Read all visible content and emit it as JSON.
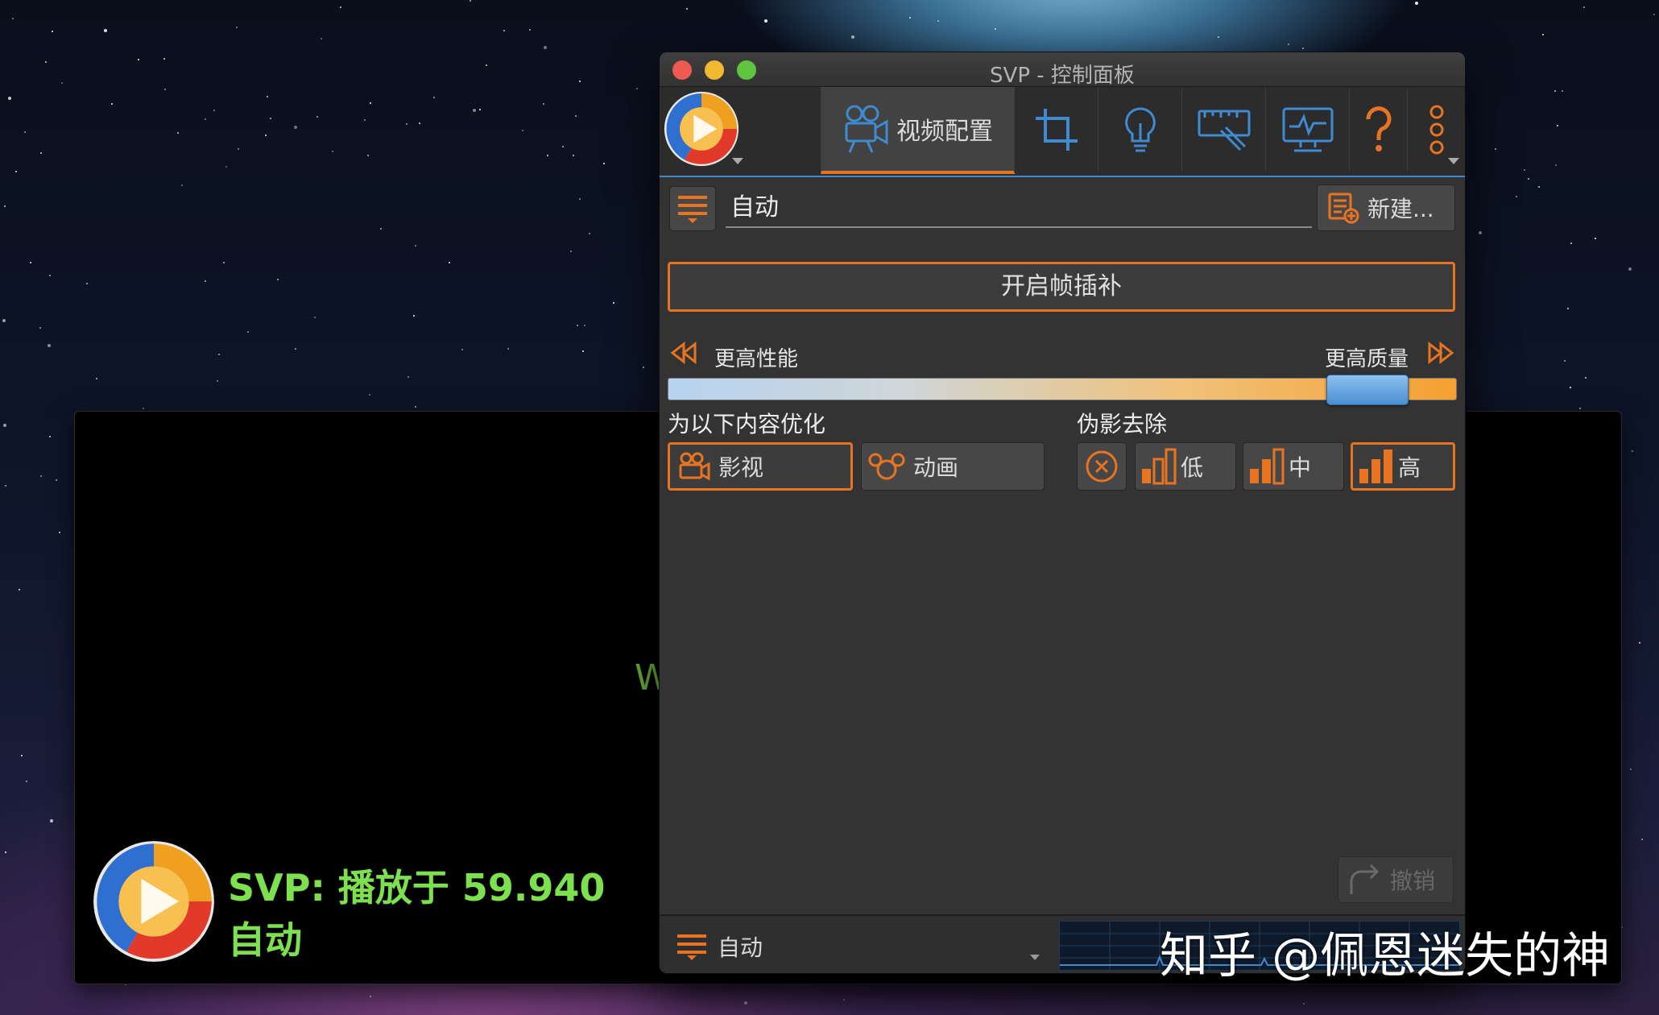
{
  "window": {
    "title": "SVP - 控制面板"
  },
  "toolbar": {
    "tabs": [
      {
        "label": "视频配置",
        "icon": "video-camera-icon",
        "active": true
      },
      {
        "label": "",
        "icon": "crop-icon",
        "active": false
      },
      {
        "label": "",
        "icon": "lightbulb-icon",
        "active": false
      },
      {
        "label": "",
        "icon": "ruler-edit-icon",
        "active": false
      },
      {
        "label": "",
        "icon": "monitor-icon",
        "active": false
      },
      {
        "label": "",
        "icon": "help-icon",
        "active": false
      },
      {
        "label": "",
        "icon": "more-vertical-icon",
        "active": false
      }
    ]
  },
  "profile": {
    "name": "自动",
    "new_button": "新建..."
  },
  "enable_button": "开启帧插补",
  "quality_slider": {
    "left_label": "更高性能",
    "right_label": "更高质量",
    "value_fraction": 0.93
  },
  "optimize": {
    "title": "为以下内容优化",
    "options": [
      {
        "label": "影视",
        "icon": "film-camera-icon",
        "selected": true
      },
      {
        "label": "动画",
        "icon": "mickey-icon",
        "selected": false
      }
    ]
  },
  "artifacts": {
    "title": "伪影去除",
    "options": [
      {
        "label": "",
        "icon": "off-circle-icon",
        "selected": false
      },
      {
        "label": "低",
        "icon": "bars-low-icon",
        "selected": false
      },
      {
        "label": "中",
        "icon": "bars-mid-icon",
        "selected": false
      },
      {
        "label": "高",
        "icon": "bars-high-icon",
        "selected": true
      }
    ]
  },
  "undo_button": "撤销",
  "statusbar": {
    "profile": "自动"
  },
  "player": {
    "partial_text": "W",
    "osd_line1": "SVP: 播放于 59.940",
    "osd_line2": "自动"
  },
  "watermark": "知乎 @佩恩迷失的神",
  "colors": {
    "accent": "#e87421",
    "highlight": "#3f8ad0",
    "osd_text": "#7de04e",
    "panel_bg": "#333333"
  }
}
